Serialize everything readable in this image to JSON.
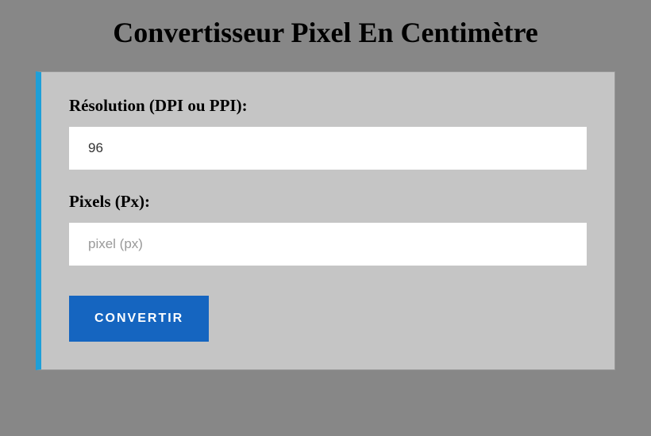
{
  "title": "Convertisseur Pixel En Centimètre",
  "form": {
    "resolution": {
      "label": "Résolution (DPI ou PPI):",
      "value": "96"
    },
    "pixels": {
      "label": "Pixels (Px):",
      "value": "",
      "placeholder": "pixel (px)"
    },
    "submit_label": "CONVERTIR"
  }
}
